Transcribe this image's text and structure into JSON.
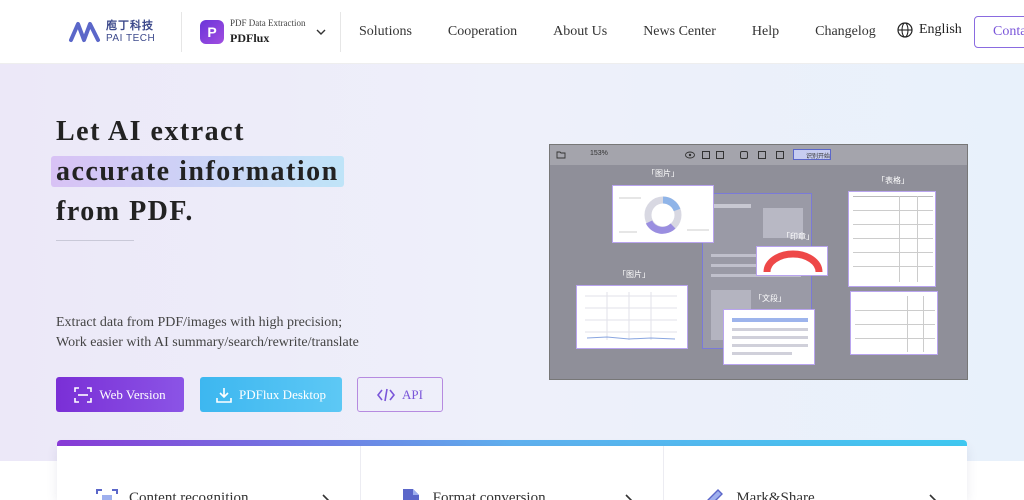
{
  "brand": {
    "cn": "庖丁科技",
    "en": "PAI TECH"
  },
  "product": {
    "subtitle": "PDF Data Extraction",
    "name": "PDFlux",
    "badge": "P"
  },
  "nav": {
    "items": [
      "Solutions",
      "Cooperation",
      "About Us",
      "News Center",
      "Help",
      "Changelog"
    ],
    "language": "English",
    "contact": "Conta"
  },
  "hero": {
    "line1": "Let AI extract",
    "line2": "accurate information",
    "line3": "from PDF.",
    "desc1": "Extract data from PDF/images with high precision;",
    "desc2": "Work easier with AI summary/search/rewrite/translate",
    "buttons": {
      "web": "Web Version",
      "desktop": "PDFlux Desktop",
      "api": "API"
    }
  },
  "mock": {
    "zoom": "153%",
    "toolbar_label": "识别开始",
    "tags": {
      "image1": "「图片」",
      "table": "「表格」",
      "seal": "「印章」",
      "image2": "「图片」",
      "text": "「文段」"
    }
  },
  "features": [
    "Content recognition",
    "Format conversion",
    "Mark&Share"
  ],
  "colors": {
    "accent": "#7a2fd6",
    "secondary": "#3db7f0",
    "text": "#222222"
  }
}
